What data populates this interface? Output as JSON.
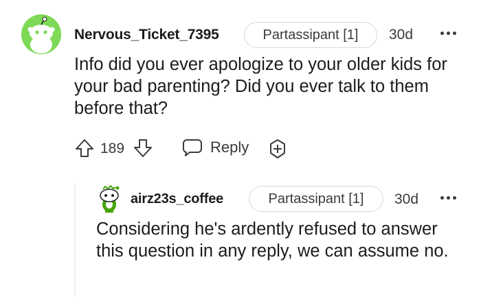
{
  "comment": {
    "username": "Nervous_Ticket_7395",
    "flair": "Partassipant [1]",
    "age": "30d",
    "body": "Info did you ever apologize to your older kids for your bad parenting? Did you ever talk to them before that?",
    "vote_count": "189",
    "reply_label": "Reply",
    "avatar_icon": "snoo-avatar-icon",
    "avatar_color": "#7ed957"
  },
  "reply": {
    "username": "airz23s_coffee",
    "flair": "Partassipant [1]",
    "age": "30d",
    "body": "Considering he's ardently refused to answer this question in any reply, we can assume no.",
    "avatar_icon": "snoo-avatar-icon",
    "avatar_color": "#46a508"
  },
  "icons": {
    "upvote": "arrow-up-icon",
    "downvote": "arrow-down-icon",
    "reply": "speech-bubble-icon",
    "award": "award-plus-icon",
    "more": "more-dots-icon"
  }
}
